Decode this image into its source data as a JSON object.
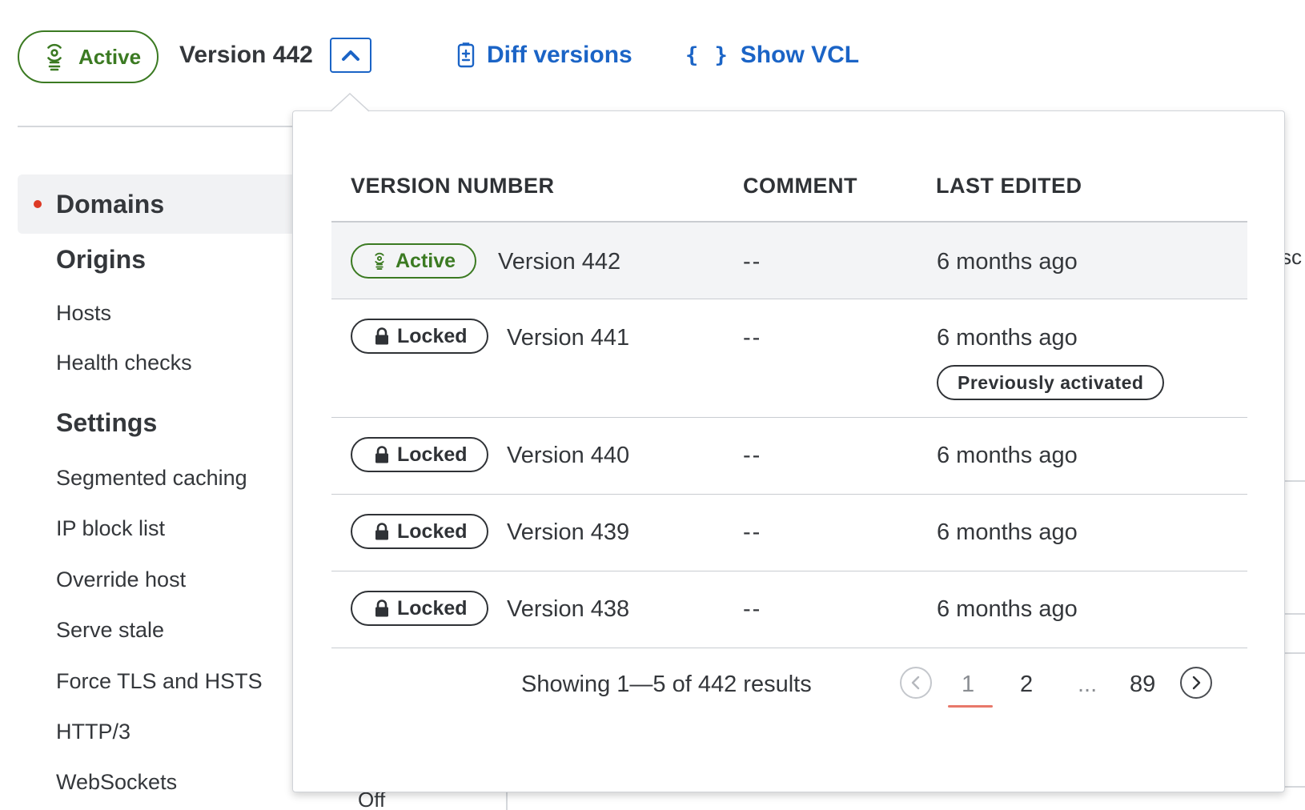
{
  "header": {
    "status_label": "Active",
    "version_label": "Version 442",
    "diff_label": "Diff versions",
    "vcl_label": "Show VCL",
    "vcl_icon_glyph": "{ }"
  },
  "sidebar": {
    "active_item": "Domains",
    "sections": [
      {
        "title": "Origins",
        "items": [
          "Hosts",
          "Health checks"
        ]
      },
      {
        "title": "Settings",
        "items": [
          "Segmented caching",
          "IP block list",
          "Override host",
          "Serve stale",
          "Force TLS and HSTS",
          "HTTP/3",
          "WebSockets"
        ]
      }
    ]
  },
  "background": {
    "value_fragment": "Off",
    "edge_fragment": "sc"
  },
  "versions_table": {
    "columns": {
      "version": "VERSION NUMBER",
      "comment": "COMMENT",
      "last_edited": "LAST EDITED"
    },
    "rows": [
      {
        "status": "Active",
        "version": "Version 442",
        "comment": "--",
        "last_edited": "6 months ago",
        "note": ""
      },
      {
        "status": "Locked",
        "version": "Version 441",
        "comment": "--",
        "last_edited": "6 months ago",
        "note": "Previously activated"
      },
      {
        "status": "Locked",
        "version": "Version 440",
        "comment": "--",
        "last_edited": "6 months ago",
        "note": ""
      },
      {
        "status": "Locked",
        "version": "Version 439",
        "comment": "--",
        "last_edited": "6 months ago",
        "note": ""
      },
      {
        "status": "Locked",
        "version": "Version 438",
        "comment": "--",
        "last_edited": "6 months ago",
        "note": ""
      }
    ]
  },
  "pagination": {
    "results_text": "Showing 1—5 of 442 results",
    "pages": [
      "1",
      "2",
      "...",
      "89"
    ],
    "current_page": "1"
  },
  "colors": {
    "active_green": "#3b7a22",
    "link_blue": "#1b64c6",
    "active_dot": "#dd3a25",
    "page_underline": "#e8786a"
  },
  "icons": {
    "status": "broadcast-icon",
    "lock": "lock-icon",
    "diff": "document-diff-icon",
    "vcl": "curly-braces-icon",
    "toggle": "chevron-up-icon",
    "prev": "chevron-left-icon",
    "next": "chevron-right-icon"
  }
}
